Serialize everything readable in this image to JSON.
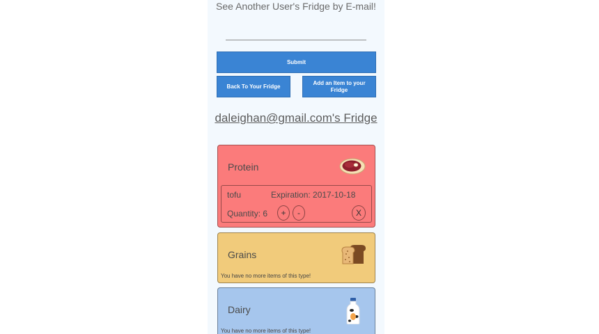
{
  "search": {
    "title": "See Another User's Fridge by E-mail!",
    "input_value": "",
    "placeholder": ""
  },
  "buttons": {
    "submit": "Submit",
    "back": "Back To Your Fridge",
    "add": "Add an Item to your Fridge"
  },
  "fridge": {
    "title": "daleighan@gmail.com's Fridge"
  },
  "categories": {
    "protein": {
      "title": "Protein",
      "icon": "steak-icon",
      "color": "#fb7b7b",
      "items": [
        {
          "name": "tofu",
          "expiration": "Expiration: 2017-10-18",
          "quantity": "Quantity: 6",
          "plus": "+",
          "minus": "-",
          "remove": "X"
        }
      ]
    },
    "grains": {
      "title": "Grains",
      "icon": "bread-icon",
      "color": "#f1cb7b",
      "empty_message": "You have no more items of this type!"
    },
    "dairy": {
      "title": "Dairy",
      "icon": "milk-bottle-icon",
      "color": "#a6c6ed",
      "empty_message": "You have no more items of this type!"
    }
  }
}
